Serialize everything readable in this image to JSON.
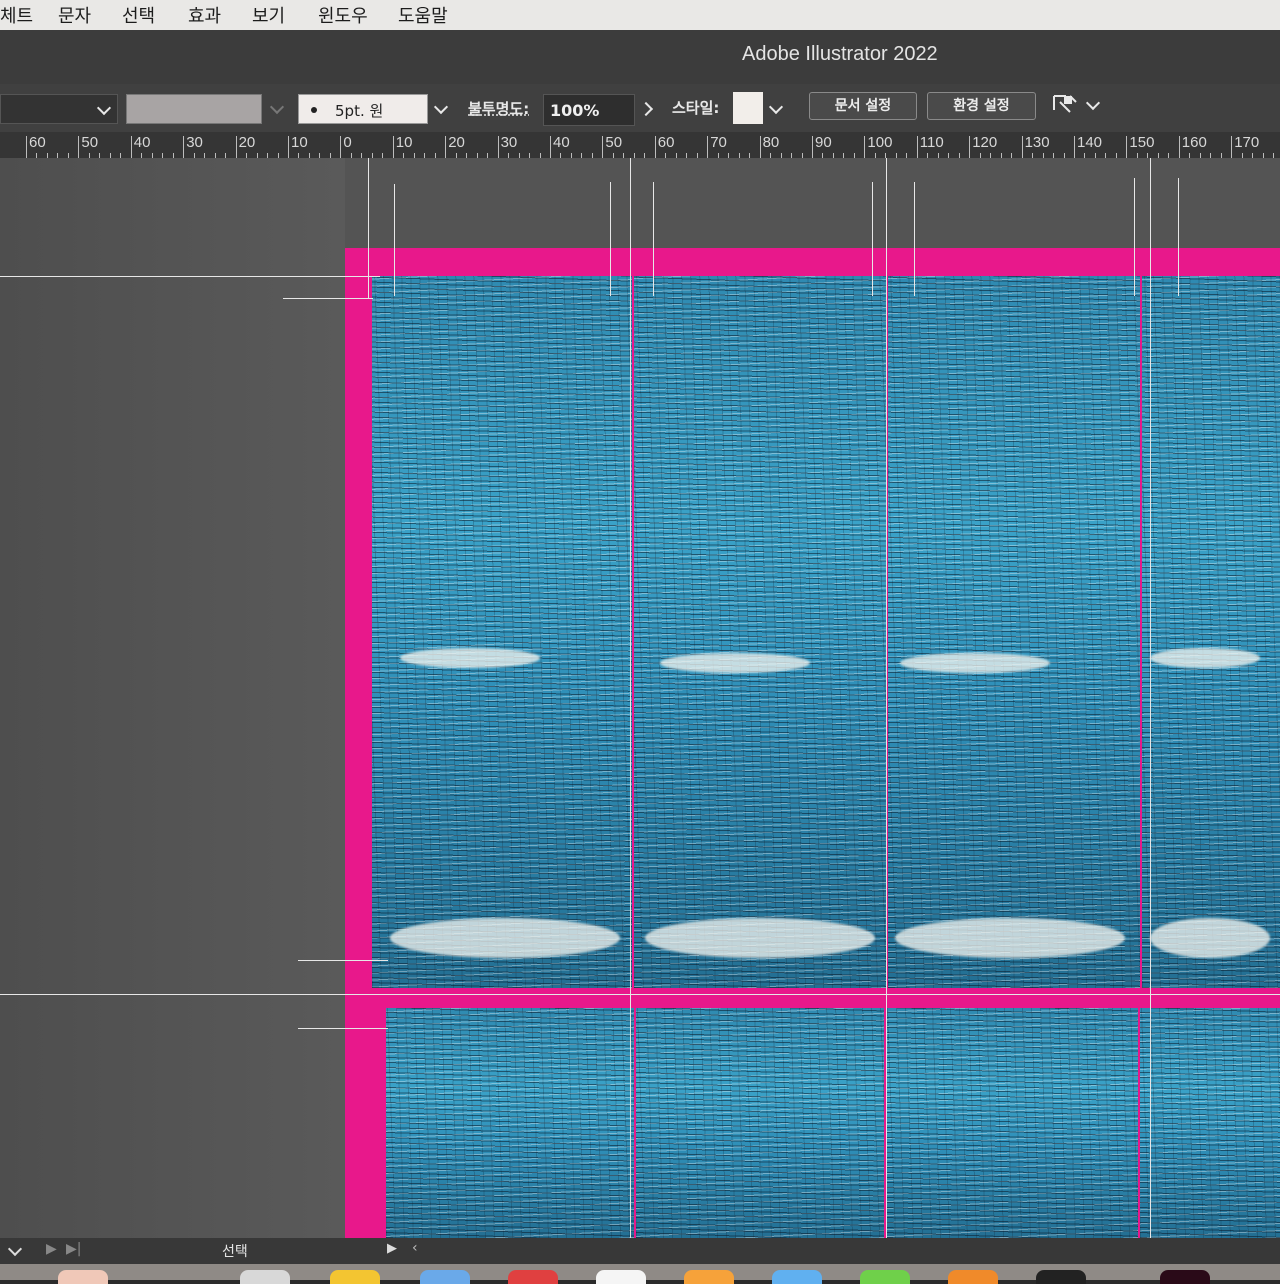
{
  "menu": {
    "items": [
      "체트",
      "문자",
      "선택",
      "효과",
      "보기",
      "윈도우",
      "도움말"
    ]
  },
  "window": {
    "title": "Adobe Illustrator 2022"
  },
  "controlbar": {
    "brush_label": "5pt. 원",
    "opacity_label": "불투명도:",
    "opacity_value": "100%",
    "style_label": "스타일:",
    "doc_setup_button": "문서 설정",
    "preferences_button": "환경 설정",
    "colors": {
      "stroke_swatch": "#a8a4a4",
      "style_swatch": "#f2eeea"
    }
  },
  "ruler": {
    "labels": [
      "60",
      "50",
      "40",
      "30",
      "20",
      "10",
      "0",
      "10",
      "20",
      "30",
      "40",
      "50",
      "60",
      "70",
      "80",
      "90",
      "100",
      "110",
      "120",
      "130",
      "140",
      "150",
      "160",
      "170"
    ]
  },
  "statusbar": {
    "tool_label": "선택"
  },
  "colors": {
    "bleed": "#e8188b",
    "water": "#3c9fc4"
  }
}
